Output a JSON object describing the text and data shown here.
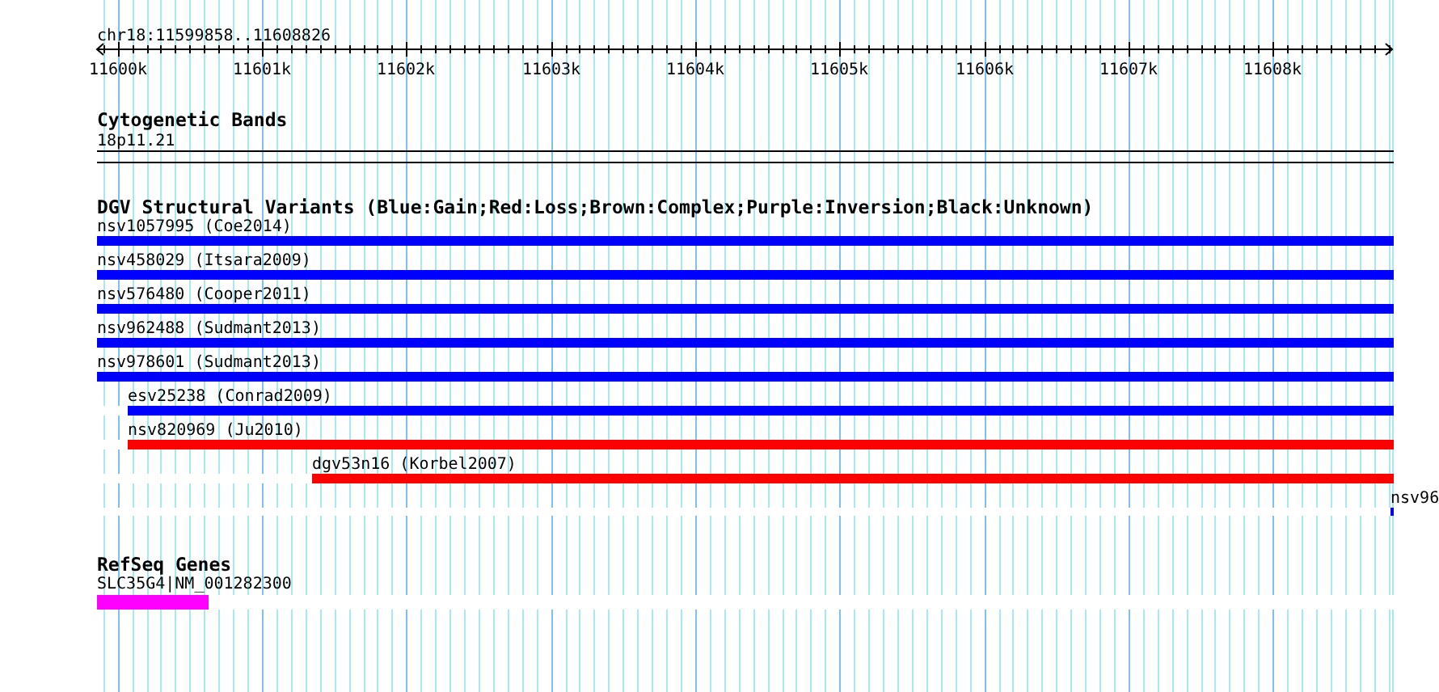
{
  "ruler": {
    "location": "chr18:11599858..11608826",
    "tick_labels": [
      "11600k",
      "11601k",
      "11602k",
      "11603k",
      "11604k",
      "11605k",
      "11606k",
      "11607k",
      "11608k"
    ]
  },
  "cytogenetic_bands": {
    "title": "Cytogenetic Bands",
    "bands": [
      {
        "label": "18p11.21"
      }
    ]
  },
  "dgv_variants": {
    "title": "DGV Structural Variants (Blue:Gain;Red:Loss;Brown:Complex;Purple:Inversion;Black:Unknown)",
    "features": [
      {
        "label": "nsv1057995 (Coe2014)",
        "color": "#0000ff"
      },
      {
        "label": "nsv458029 (Itsara2009)",
        "color": "#0000ff"
      },
      {
        "label": "nsv576480 (Cooper2011)",
        "color": "#0000ff"
      },
      {
        "label": "nsv962488 (Sudmant2013)",
        "color": "#0000ff"
      },
      {
        "label": "nsv978601 (Sudmant2013)",
        "color": "#0000ff"
      },
      {
        "label": "esv25238 (Conrad2009)",
        "color": "#0000ff",
        "level": 0.976
      },
      {
        "label": "nsv820969 (Ju2010)",
        "color": "#ff0000",
        "level": 0.976
      },
      {
        "label": "dgv53n16 (Korbel2007)",
        "color": "#ff0000",
        "level": 0.834
      },
      {
        "label": "nsv96",
        "color": "#0000ff",
        "level": 0.003
      }
    ]
  },
  "refseq_genes": {
    "title": "RefSeq Genes",
    "genes": [
      {
        "label": "SLC35G4|NM_001282300",
        "level": 0.086
      }
    ]
  }
}
